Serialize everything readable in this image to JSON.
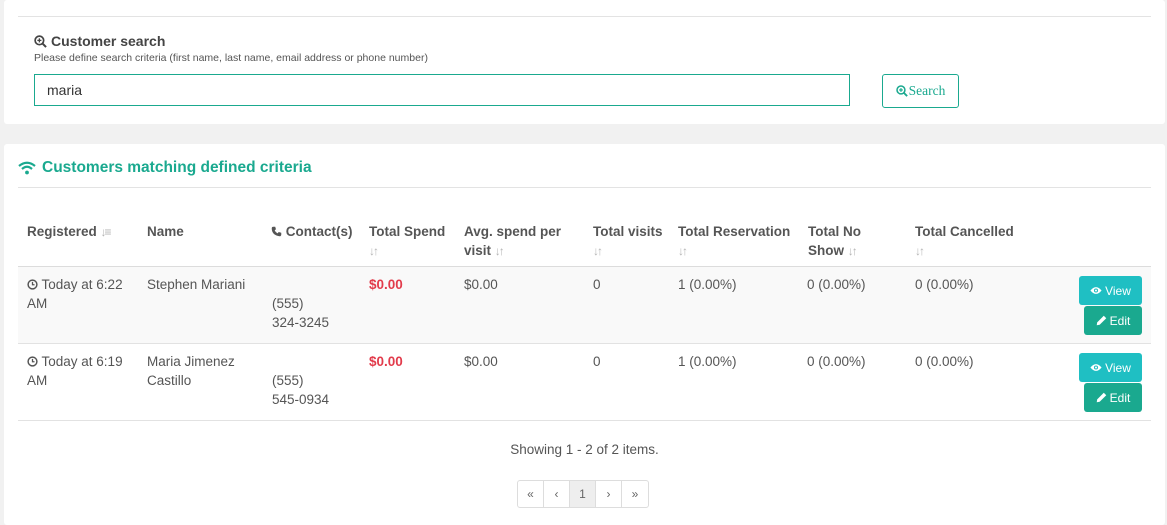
{
  "search": {
    "title": "Customer search",
    "hint": "Please define search criteria (first name, last name, email address or phone number)",
    "value": "maria",
    "button_label": "Search"
  },
  "results": {
    "title": "Customers matching defined criteria",
    "columns": {
      "registered": "Registered",
      "name": "Name",
      "contacts": "Contact(s)",
      "total_spend": "Total Spend",
      "avg_spend": "Avg. spend per visit",
      "total_visits": "Total visits",
      "total_reservation": "Total Reservation",
      "total_no_show": "Total No Show",
      "total_cancelled": "Total Cancelled"
    },
    "rows": [
      {
        "registered": "Today at 6:22 AM",
        "name": "Stephen Mariani",
        "contact": "(555) 324-3245",
        "total_spend": "$0.00",
        "avg_spend": "$0.00",
        "total_visits": "0",
        "total_reservation": "1 (0.00%)",
        "total_no_show": "0 (0.00%)",
        "total_cancelled": "0 (0.00%)",
        "view_label": "View",
        "edit_label": "Edit"
      },
      {
        "registered": "Today at 6:19 AM",
        "name": "Maria Jimenez Castillo",
        "contact": "(555) 545-0934",
        "total_spend": "$0.00",
        "avg_spend": "$0.00",
        "total_visits": "0",
        "total_reservation": "1 (0.00%)",
        "total_no_show": "0 (0.00%)",
        "total_cancelled": "0 (0.00%)",
        "view_label": "View",
        "edit_label": "Edit"
      }
    ],
    "summary": "Showing 1 - 2 of 2 items."
  },
  "pagination": {
    "first": "«",
    "prev": "‹",
    "current": "1",
    "next": "›",
    "last": "»"
  },
  "colors": {
    "accent": "#1aa98f",
    "view_button": "#1fbfc3",
    "negative": "#e23b4b"
  }
}
